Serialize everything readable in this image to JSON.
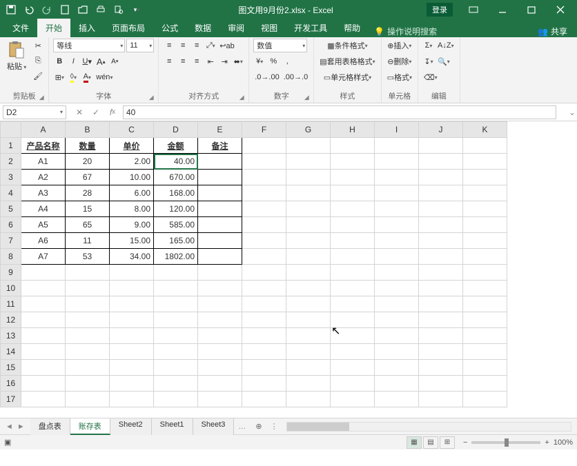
{
  "title": "图文用9月份2.xlsx - Excel",
  "login_label": "登录",
  "tabs": {
    "file": "文件",
    "home": "开始",
    "insert": "插入",
    "layout": "页面布局",
    "formulas": "公式",
    "data": "数据",
    "review": "审阅",
    "view": "视图",
    "dev": "开发工具",
    "help": "帮助",
    "tellme": "操作说明搜索",
    "share": "共享"
  },
  "ribbon": {
    "clipboard": {
      "label": "剪贴板",
      "paste": "粘贴"
    },
    "font": {
      "label": "字体",
      "name": "等线",
      "size": "11",
      "ruby": "wén"
    },
    "align": {
      "label": "对齐方式"
    },
    "number": {
      "label": "数字",
      "format": "数值"
    },
    "styles": {
      "label": "样式",
      "cond": "条件格式",
      "table": "套用表格格式",
      "cell": "单元格样式"
    },
    "cells": {
      "label": "单元格",
      "insert": "插入",
      "delete": "删除",
      "format": "格式"
    },
    "editing": {
      "label": "编辑"
    }
  },
  "namebox": "D2",
  "formula": "40",
  "columns": [
    "A",
    "B",
    "C",
    "D",
    "E",
    "F",
    "G",
    "H",
    "I",
    "J",
    "K"
  ],
  "rows": [
    "1",
    "2",
    "3",
    "4",
    "5",
    "6",
    "7",
    "8",
    "9",
    "10",
    "11",
    "12",
    "13",
    "14",
    "15",
    "16",
    "17"
  ],
  "headers": [
    "产品名称",
    "数量",
    "单价",
    "金额",
    "备注"
  ],
  "chart_data": {
    "type": "table",
    "columns": [
      "产品名称",
      "数量",
      "单价",
      "金额",
      "备注"
    ],
    "rows": [
      {
        "产品名称": "A1",
        "数量": 20,
        "单价": "2.00",
        "金额": "40.00",
        "备注": ""
      },
      {
        "产品名称": "A2",
        "数量": 67,
        "单价": "10.00",
        "金额": "670.00",
        "备注": ""
      },
      {
        "产品名称": "A3",
        "数量": 28,
        "单价": "6.00",
        "金额": "168.00",
        "备注": ""
      },
      {
        "产品名称": "A4",
        "数量": 15,
        "单价": "8.00",
        "金额": "120.00",
        "备注": ""
      },
      {
        "产品名称": "A5",
        "数量": 65,
        "单价": "9.00",
        "金额": "585.00",
        "备注": ""
      },
      {
        "产品名称": "A6",
        "数量": 11,
        "单价": "15.00",
        "金额": "165.00",
        "备注": ""
      },
      {
        "产品名称": "A7",
        "数量": 53,
        "单价": "34.00",
        "金额": "1802.00",
        "备注": ""
      }
    ]
  },
  "sheets": [
    "盘点表",
    "账存表",
    "Sheet2",
    "Sheet1",
    "Sheet3"
  ],
  "active_sheet": 1,
  "zoom": "100%"
}
